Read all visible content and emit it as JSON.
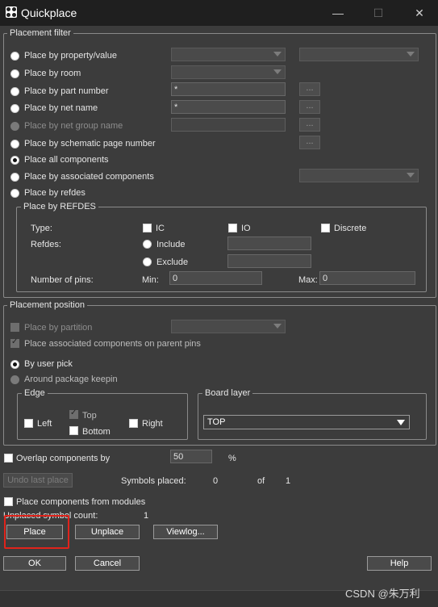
{
  "window": {
    "title": "Quickplace",
    "minimize": "—",
    "maximize": "☐",
    "close": "✕"
  },
  "placement_filter": {
    "title": "Placement filter",
    "options": [
      "Place by property/value",
      "Place by room",
      "Place by part number",
      "Place by net name",
      "Place by net group name",
      "Place by schematic page number",
      "Place all components",
      "Place by associated components",
      "Place by refdes"
    ],
    "part_number_value": "*",
    "net_name_value": "*",
    "browse_label": "..."
  },
  "refdes_group": {
    "title": "Place by REFDES",
    "type_label": "Type:",
    "type_ic": "IC",
    "type_io": "IO",
    "type_discrete": "Discrete",
    "refdes_label": "Refdes:",
    "include": "Include",
    "exclude": "Exclude",
    "pins_label": "Number of pins:",
    "min_label": "Min:",
    "min_value": "0",
    "max_label": "Max:",
    "max_value": "0"
  },
  "placement_position": {
    "title": "Placement position",
    "by_partition": "Place by partition",
    "associated_parent": "Place associated components on parent pins",
    "by_user_pick": "By user pick",
    "around_keepin": "Around package keepin",
    "edge": {
      "title": "Edge",
      "left": "Left",
      "top": "Top",
      "right": "Right",
      "bottom": "Bottom"
    },
    "board_layer": {
      "title": "Board layer",
      "selected": "TOP"
    }
  },
  "overlap": {
    "label": "Overlap components by",
    "value": "50",
    "unit": "%"
  },
  "undo_last_place": "Undo last place",
  "symbols_placed": {
    "label": "Symbols placed:",
    "count": "0",
    "of": "of",
    "total": "1"
  },
  "from_modules": "Place components from modules",
  "unplaced": {
    "label": "Unplaced symbol count:",
    "count": "1"
  },
  "buttons": {
    "place": "Place",
    "unplace": "Unplace",
    "viewlog": "Viewlog...",
    "ok": "OK",
    "cancel": "Cancel",
    "help": "Help"
  },
  "watermark": "CSDN @朱万利"
}
